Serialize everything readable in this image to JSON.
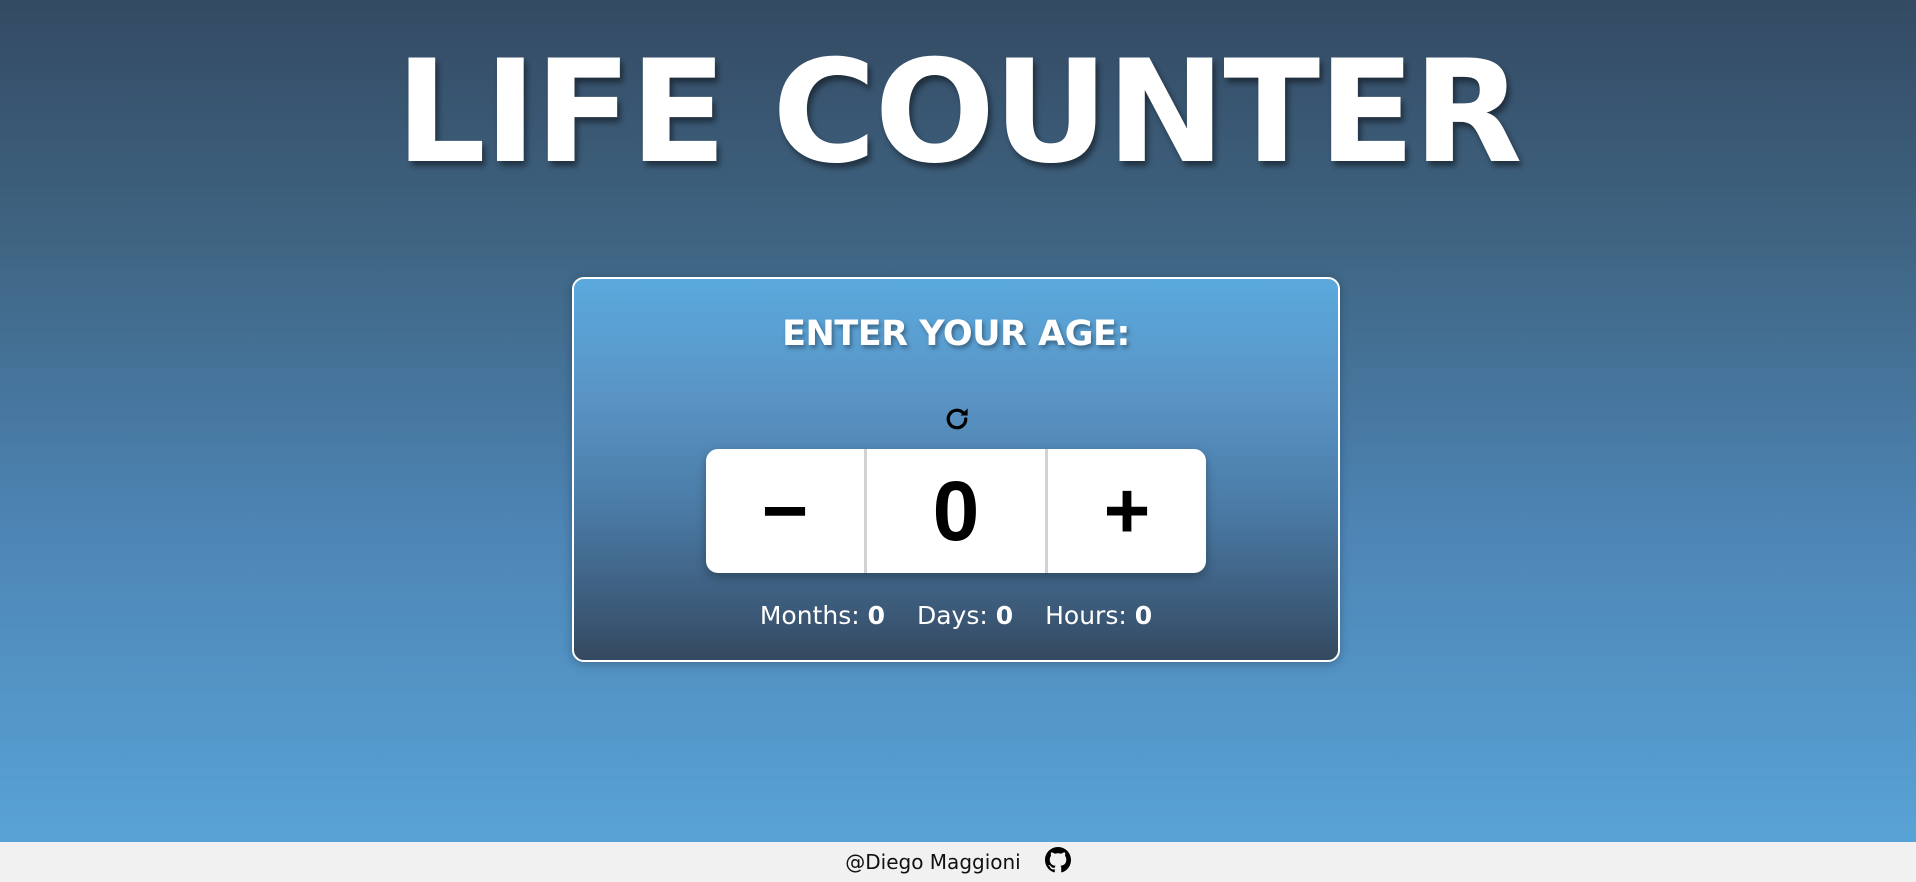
{
  "app": {
    "title": "LIFE COUNTER"
  },
  "card": {
    "heading": "ENTER YOUR AGE:",
    "reset_icon": "refresh-icon",
    "counter": {
      "decrement_label": "−",
      "value": "0",
      "increment_label": "+"
    },
    "stats": [
      {
        "label": "Months:",
        "value": "0"
      },
      {
        "label": "Days:",
        "value": "0"
      },
      {
        "label": "Hours:",
        "value": "0"
      }
    ]
  },
  "footer": {
    "author": "@Diego Maggioni",
    "link_icon": "github-icon"
  },
  "colors": {
    "background_top": "#344a63",
    "background_bottom": "#5aa7da",
    "card_border": "#ffffff",
    "counter_bg": "#ffffff",
    "footer_bg": "#f1f1f1"
  }
}
